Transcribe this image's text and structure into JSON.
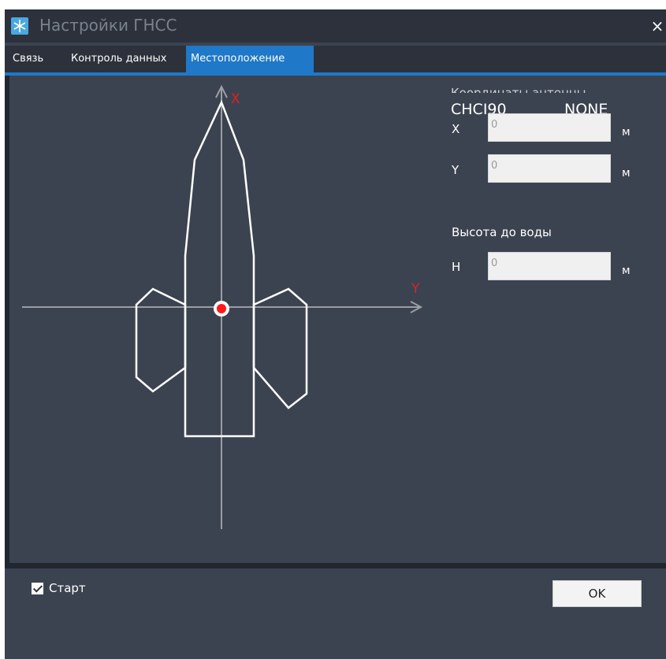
{
  "window": {
    "title": "Настройки ГНСС",
    "close_glyph": "×",
    "icon": "snowflake-app-icon"
  },
  "tabs": [
    {
      "label": "Связь",
      "active": false
    },
    {
      "label": "Контроль данных",
      "active": false
    },
    {
      "label": "Местоположение",
      "active": true
    }
  ],
  "diagram": {
    "axis_x_label": "X",
    "axis_y_label": "Y"
  },
  "antenna": {
    "heading_label": "Координаты антенны",
    "coord_system": "CHCI90",
    "mode": "NONE",
    "x_label": "X",
    "x_value": "0",
    "y_label": "Y",
    "y_value": "0",
    "unit": "м"
  },
  "water_height": {
    "heading_label": "Высота до воды",
    "h_label": "H",
    "h_value": "0",
    "unit": "м"
  },
  "footer": {
    "start_label": "Старт",
    "start_checked": true,
    "ok_label": "OK"
  },
  "colors": {
    "window_bg": "#3c4350",
    "titlebar_bg": "#2c313b",
    "accent": "#1f78c8",
    "axis_label": "#e02020",
    "center_marker": "#ff1a1a"
  }
}
